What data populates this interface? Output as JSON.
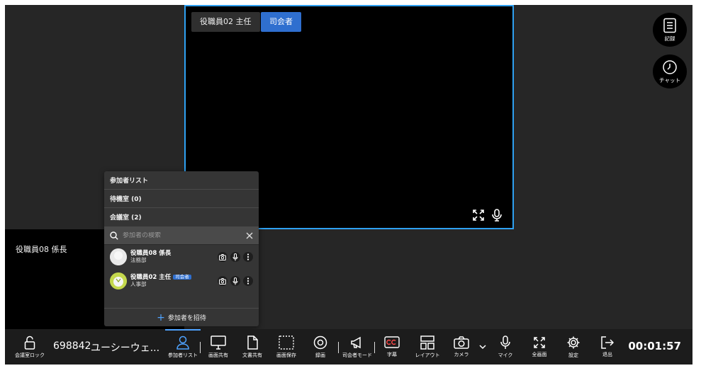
{
  "main_tile": {
    "name_chip": "役職員02 主任",
    "role_chip": "司会者"
  },
  "side_tile": {
    "name": "役職員08 係長"
  },
  "rail": {
    "record_label": "記録",
    "chat_label": "チャット"
  },
  "panel": {
    "title": "参加者リスト",
    "waiting_room": "待機室 (0)",
    "meeting_room": "会議室 (2)",
    "search_placeholder": "参加者の検索",
    "participants": [
      {
        "name": "役職員08 係長",
        "dept": "法務部",
        "badge": ""
      },
      {
        "name": "役職員02 主任",
        "dept": "人事部",
        "badge": "司会者"
      }
    ],
    "invite_label": "参加者を招待"
  },
  "toolbar": {
    "lock_label": "会議室ロック",
    "meeting_id": "698842",
    "meeting_name": "ユーシーウェ...",
    "participants_label": "参加者リスト",
    "screen_share_label": "画面共有",
    "doc_share_label": "文書共有",
    "screenshot_label": "画面保存",
    "record_label": "録画",
    "host_mode_label": "司会者モード",
    "caption_label": "字幕",
    "layout_label": "レイアウト",
    "camera_label": "カメラ",
    "mic_label": "マイク",
    "fullscreen_label": "全画面",
    "settings_label": "設定",
    "leave_label": "退出",
    "timer": "00:01:57"
  },
  "colors": {
    "accent": "#2ea1f2",
    "host_badge": "#2f6fcf",
    "background": "#262626",
    "toolbar": "#1c1c1c"
  }
}
